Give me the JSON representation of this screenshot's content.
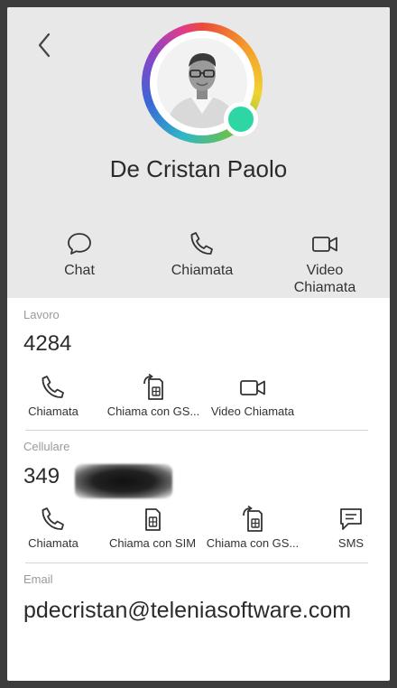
{
  "contact": {
    "name": "De Cristan Paolo",
    "presence_status": "online",
    "presence_color": "#2fd6a5"
  },
  "header_actions": [
    {
      "label": "Chat",
      "icon": "chat-bubble-icon"
    },
    {
      "label": "Chiamata",
      "icon": "phone-icon"
    },
    {
      "label": "Video\nChiamata",
      "icon": "video-camera-icon"
    }
  ],
  "work": {
    "label": "Lavoro",
    "number": "4284",
    "actions": [
      {
        "label": "Chiamata",
        "icon": "phone-icon"
      },
      {
        "label": "Chiama con GS...",
        "icon": "sim-forward-icon"
      },
      {
        "label": "Video Chiamata",
        "icon": "video-camera-icon"
      }
    ]
  },
  "mobile": {
    "label": "Cellulare",
    "number_visible": "349",
    "actions": [
      {
        "label": "Chiamata",
        "icon": "phone-icon"
      },
      {
        "label": "Chiama con SIM",
        "icon": "sim-icon"
      },
      {
        "label": "Chiama con GS...",
        "icon": "sim-forward-icon"
      },
      {
        "label": "SMS",
        "icon": "sms-icon"
      }
    ]
  },
  "email": {
    "label": "Email",
    "value": "pdecristan@teleniasoftware.com"
  },
  "colors": {
    "header_bg": "#e8e8e8",
    "presence": "#2fd6a5",
    "frame_border": "#3c3c3c"
  }
}
